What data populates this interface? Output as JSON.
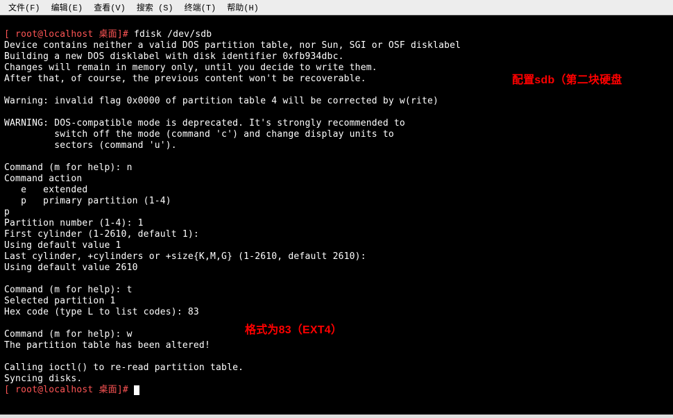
{
  "menubar": {
    "file": "文件(F)",
    "edit": "编辑(E)",
    "view": "查看(V)",
    "search": "搜索 (S)",
    "terminal": "终端(T)",
    "help": "帮助(H)"
  },
  "prompt1": {
    "userhost": "[ root@localhost 桌面]# ",
    "command": "fdisk /dev/sdb"
  },
  "lines": {
    "l1": "Device contains neither a valid DOS partition table, nor Sun, SGI or OSF disklabel",
    "l2": "Building a new DOS disklabel with disk identifier 0xfb934dbc.",
    "l3": "Changes will remain in memory only, until you decide to write them.",
    "l4": "After that, of course, the previous content won't be recoverable.",
    "l5": "",
    "l6": "Warning: invalid flag 0x0000 of partition table 4 will be corrected by w(rite)",
    "l7": "",
    "l8": "WARNING: DOS-compatible mode is deprecated. It's strongly recommended to",
    "l9": "         switch off the mode (command 'c') and change display units to",
    "l10": "         sectors (command 'u').",
    "l11": "",
    "l12": "Command (m for help): n",
    "l13": "Command action",
    "l14": "   e   extended",
    "l15": "   p   primary partition (1-4)",
    "l16": "p",
    "l17": "Partition number (1-4): 1",
    "l18": "First cylinder (1-2610, default 1):",
    "l19": "Using default value 1",
    "l20": "Last cylinder, +cylinders or +size{K,M,G} (1-2610, default 2610):",
    "l21": "Using default value 2610",
    "l22": "",
    "l23": "Command (m for help): t",
    "l24": "Selected partition 1",
    "l25": "Hex code (type L to list codes): 83",
    "l26": "",
    "l27": "Command (m for help): w",
    "l28": "The partition table has been altered!",
    "l29": "",
    "l30": "Calling ioctl() to re-read partition table.",
    "l31": "Syncing disks."
  },
  "prompt2": {
    "userhost": "[ root@localhost 桌面]# "
  },
  "annotations": {
    "a1": "配置sdb（第二块硬盘",
    "a2": "格式为83（EXT4）"
  }
}
